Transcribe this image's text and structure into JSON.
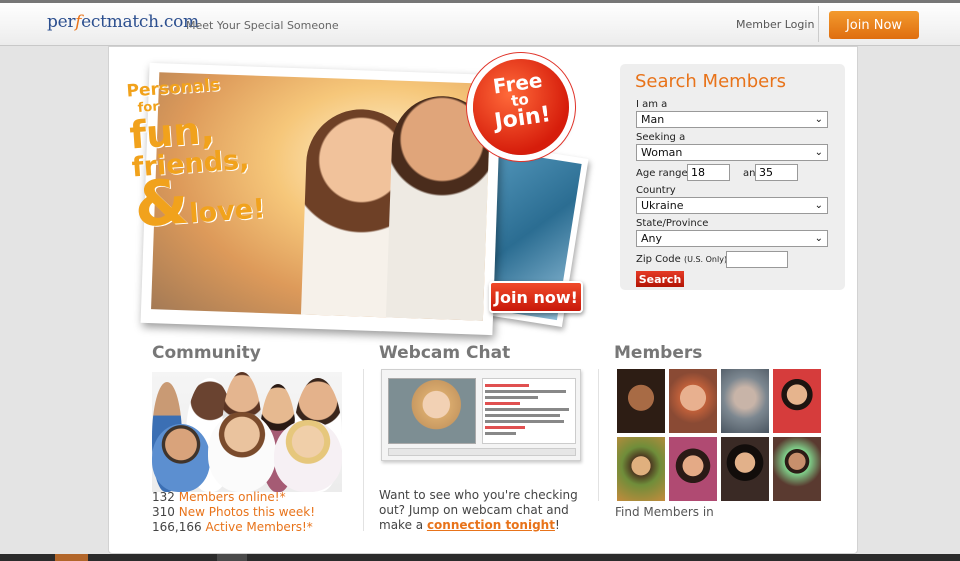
{
  "header": {
    "logo_part1": "per",
    "logo_accent": "f",
    "logo_part2": "ectmatch.com",
    "tagline": "Meet Your Special Someone",
    "login": "Member Login",
    "join": "Join Now"
  },
  "hero": {
    "line1": "Personals",
    "line2": "for",
    "line3": "fun,",
    "line4": "friends,",
    "amp": "&",
    "line5": "love!",
    "burst1": "Free",
    "burst2": "to",
    "burst3": "Join!",
    "join_now": "Join now!"
  },
  "search": {
    "title": "Search Members",
    "iam_label": "I am a",
    "iam_value": "Man",
    "seeking_label": "Seeking a",
    "seeking_value": "Woman",
    "age_label": "Age range",
    "age_min": "18",
    "age_and": "and",
    "age_max": "35",
    "country_label": "Country",
    "country_value": "Ukraine",
    "state_label": "State/Province",
    "state_value": "Any",
    "zip_label": "Zip Code",
    "zip_note": "(U.S. Only)",
    "search_btn": "Search"
  },
  "community": {
    "title": "Community",
    "stat1_num": "132",
    "stat1_text": "Members online!*",
    "stat2_num": "310",
    "stat2_text": "New Photos this week!",
    "stat3_num": "166,166",
    "stat3_text": "Active Members!*"
  },
  "webcam": {
    "title": "Webcam Chat",
    "text": "Want to see who you're checking out? Jump on webcam chat and make a ",
    "link": "connection tonight",
    "end": "!"
  },
  "members": {
    "title": "Members",
    "find": "Find Members in"
  },
  "colors": {
    "accent": "#e8731a",
    "brand": "#2c4f8f",
    "cta_red": "#c8180a"
  }
}
